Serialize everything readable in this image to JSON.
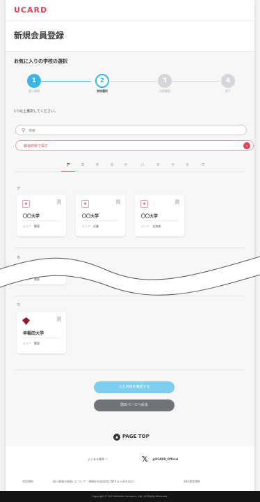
{
  "header": {
    "logo": "UCARD",
    "page_title": "新規会員登録"
  },
  "section_title": "お気に入りの学校の選択",
  "steps": [
    {
      "num": "1",
      "label": "個人情報",
      "state": "done"
    },
    {
      "num": "2",
      "label": "学校選択",
      "state": "current"
    },
    {
      "num": "3",
      "label": "内容確認",
      "state": "todo"
    },
    {
      "num": "4",
      "label": "完了",
      "state": "todo"
    }
  ],
  "instruction": "1つ以上選択してください。",
  "search": {
    "placeholder": "検索",
    "icon": "search-icon"
  },
  "prefecture_select": {
    "value": "都道府県で探す"
  },
  "kana_tabs": [
    "ア",
    "カ",
    "サ",
    "タ",
    "ナ",
    "ハ",
    "マ",
    "ヤ",
    "ラ",
    "ワ"
  ],
  "groups": {
    "a": {
      "label": "ア",
      "cards": [
        {
          "name": "〇〇大学",
          "area_label": "エリア",
          "area": "関東"
        },
        {
          "name": "〇〇大学",
          "area_label": "エリア",
          "area": "近畿"
        },
        {
          "name": "〇〇大学",
          "area_label": "エリア",
          "area": "北海道"
        }
      ]
    },
    "ka": {
      "label": "カ",
      "area_label": "エリア",
      "area": "関東"
    },
    "wa": {
      "label": "ワ",
      "cards": [
        {
          "name": "早稲田大学",
          "area_label": "エリア",
          "area": "関東"
        }
      ]
    }
  },
  "buttons": {
    "confirm": "入力内容を確認する",
    "back": "前のページへ戻る"
  },
  "page_top": "PAGE TOP",
  "footer": {
    "faq": "よくある質問",
    "x_handle": "@UCARD_Official",
    "links": [
      "利用規約",
      "個人情報の取扱いについて（情報の外部送信に関する公表を含む）",
      "SNS運営規約"
    ],
    "copyright": "Copyright © D-K Solutions Company, Ltd. All Rights Reserved."
  },
  "colors": {
    "accent": "#e4415a",
    "step_blue": "#3ab7e6",
    "confirm_btn": "#7ccdee",
    "back_btn": "#707378"
  }
}
